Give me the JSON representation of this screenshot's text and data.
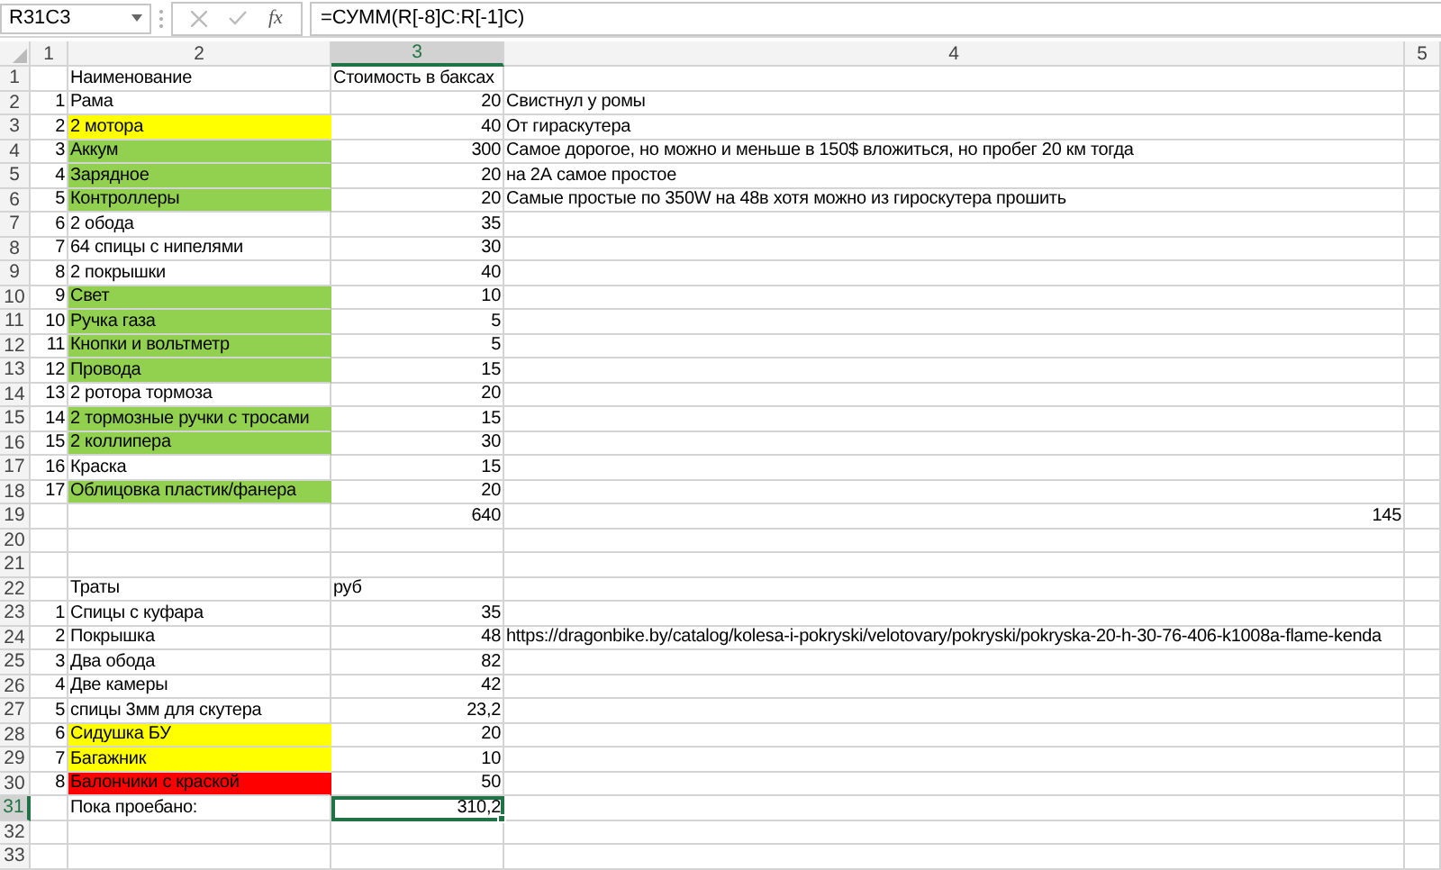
{
  "name_box": "R31C3",
  "function_label": "fx",
  "formula": "=СУММ(R[-8]C:R[-1]C)",
  "columns": [
    {
      "label": "1",
      "selected": false
    },
    {
      "label": "2",
      "selected": false
    },
    {
      "label": "3",
      "selected": true
    },
    {
      "label": "4",
      "selected": false
    },
    {
      "label": "5",
      "selected": false
    }
  ],
  "rows": [
    {
      "header": "1",
      "kind": "header",
      "selected": false,
      "c2": "Наименование",
      "c3": "Стоимость в баксах"
    },
    {
      "header": "2",
      "kind": "item",
      "selected": false,
      "c1": "1",
      "c2": "Рама",
      "c3": "20",
      "c4": "Свистнул у ромы"
    },
    {
      "header": "3",
      "kind": "item",
      "selected": false,
      "c1": "2",
      "c2": "2 мотора",
      "c3": "40",
      "c4": "От гираскутера",
      "color": "#ffff00"
    },
    {
      "header": "4",
      "kind": "item",
      "selected": false,
      "c1": "3",
      "c2": "Аккум",
      "c3": "300",
      "c4": "Самое дорогое, но можно и меньше в 150$ вложиться, но пробег 20 км тогда",
      "color": "#92d050"
    },
    {
      "header": "5",
      "kind": "item",
      "selected": false,
      "c1": "4",
      "c2": "Зарядное",
      "c3": "20",
      "c4": "на 2А самое простое",
      "color": "#92d050"
    },
    {
      "header": "6",
      "kind": "item",
      "selected": false,
      "c1": "5",
      "c2": "Контроллеры",
      "c3": "20",
      "c4": "Самые простые по 350W на 48в хотя можно из гироскутера прошить",
      "color": "#92d050"
    },
    {
      "header": "7",
      "kind": "item",
      "selected": false,
      "c1": "6",
      "c2": "2 обода",
      "c3": "35"
    },
    {
      "header": "8",
      "kind": "item",
      "selected": false,
      "c1": "7",
      "c2": "64 спицы с нипелями",
      "c3": "30"
    },
    {
      "header": "9",
      "kind": "item",
      "selected": false,
      "c1": "8",
      "c2": "2 покрышки",
      "c3": "40"
    },
    {
      "header": "10",
      "kind": "item",
      "selected": false,
      "c1": "9",
      "c2": "Свет",
      "c3": "10",
      "color": "#92d050"
    },
    {
      "header": "11",
      "kind": "item",
      "selected": false,
      "c1": "10",
      "c2": "Ручка газа",
      "c3": "5",
      "color": "#92d050"
    },
    {
      "header": "12",
      "kind": "item",
      "selected": false,
      "c1": "11",
      "c2": "Кнопки и вольтметр",
      "c3": "5",
      "color": "#92d050"
    },
    {
      "header": "13",
      "kind": "item",
      "selected": false,
      "c1": "12",
      "c2": "Провода",
      "c3": "15",
      "color": "#92d050"
    },
    {
      "header": "14",
      "kind": "item",
      "selected": false,
      "c1": "13",
      "c2": "2 ротора тормоза",
      "c3": "20"
    },
    {
      "header": "15",
      "kind": "item",
      "selected": false,
      "c1": "14",
      "c2": "2 тормозные ручки с тросами",
      "c3": "15",
      "color": "#92d050"
    },
    {
      "header": "16",
      "kind": "item",
      "selected": false,
      "c1": "15",
      "c2": "2 коллипера",
      "c3": "30",
      "color": "#92d050"
    },
    {
      "header": "17",
      "kind": "item",
      "selected": false,
      "c1": "16",
      "c2": "Краска",
      "c3": "15"
    },
    {
      "header": "18",
      "kind": "item",
      "selected": false,
      "c1": "17",
      "c2": "Облицовка пластик/фанера",
      "c3": "20",
      "color": "#92d050"
    },
    {
      "header": "19",
      "kind": "total",
      "selected": false,
      "c3": "640",
      "c4": "145"
    },
    {
      "header": "20",
      "kind": "blank",
      "selected": false
    },
    {
      "header": "21",
      "kind": "blank",
      "selected": false
    },
    {
      "header": "22",
      "kind": "header",
      "selected": false,
      "c2": "Траты",
      "c3": "руб"
    },
    {
      "header": "23",
      "kind": "item",
      "selected": false,
      "c1": "1",
      "c2": "Спицы с куфара",
      "c3": "35"
    },
    {
      "header": "24",
      "kind": "item",
      "selected": false,
      "c1": "2",
      "c2": "Покрышка",
      "c3": "48",
      "c4": "https://dragonbike.by/catalog/kolesa-i-pokryski/velotovary/pokryski/pokryska-20-h-30-76-406-k1008a-flame-kenda"
    },
    {
      "header": "25",
      "kind": "item",
      "selected": false,
      "c1": "3",
      "c2": "Два обода",
      "c3": "82"
    },
    {
      "header": "26",
      "kind": "item",
      "selected": false,
      "c1": "4",
      "c2": "Две камеры",
      "c3": "42"
    },
    {
      "header": "27",
      "kind": "item",
      "selected": false,
      "c1": "5",
      "c2": "спицы 3мм для скутера",
      "c3": "23,2"
    },
    {
      "header": "28",
      "kind": "item",
      "selected": false,
      "c1": "6",
      "c2": "Сидушка БУ",
      "c3": "20",
      "color": "#ffff00"
    },
    {
      "header": "29",
      "kind": "item",
      "selected": false,
      "c1": "7",
      "c2": "Багажник",
      "c3": "10",
      "color": "#ffff00"
    },
    {
      "header": "30",
      "kind": "item",
      "selected": false,
      "c1": "8",
      "c2": "Балончики с краской",
      "c3": "50",
      "color": "#ff0000"
    },
    {
      "header": "31",
      "kind": "item",
      "selected": true,
      "c2": "Пока проебано:",
      "c3": "310,2"
    },
    {
      "header": "32",
      "kind": "blank",
      "selected": false
    },
    {
      "header": "33",
      "kind": "blank",
      "selected": false
    }
  ]
}
